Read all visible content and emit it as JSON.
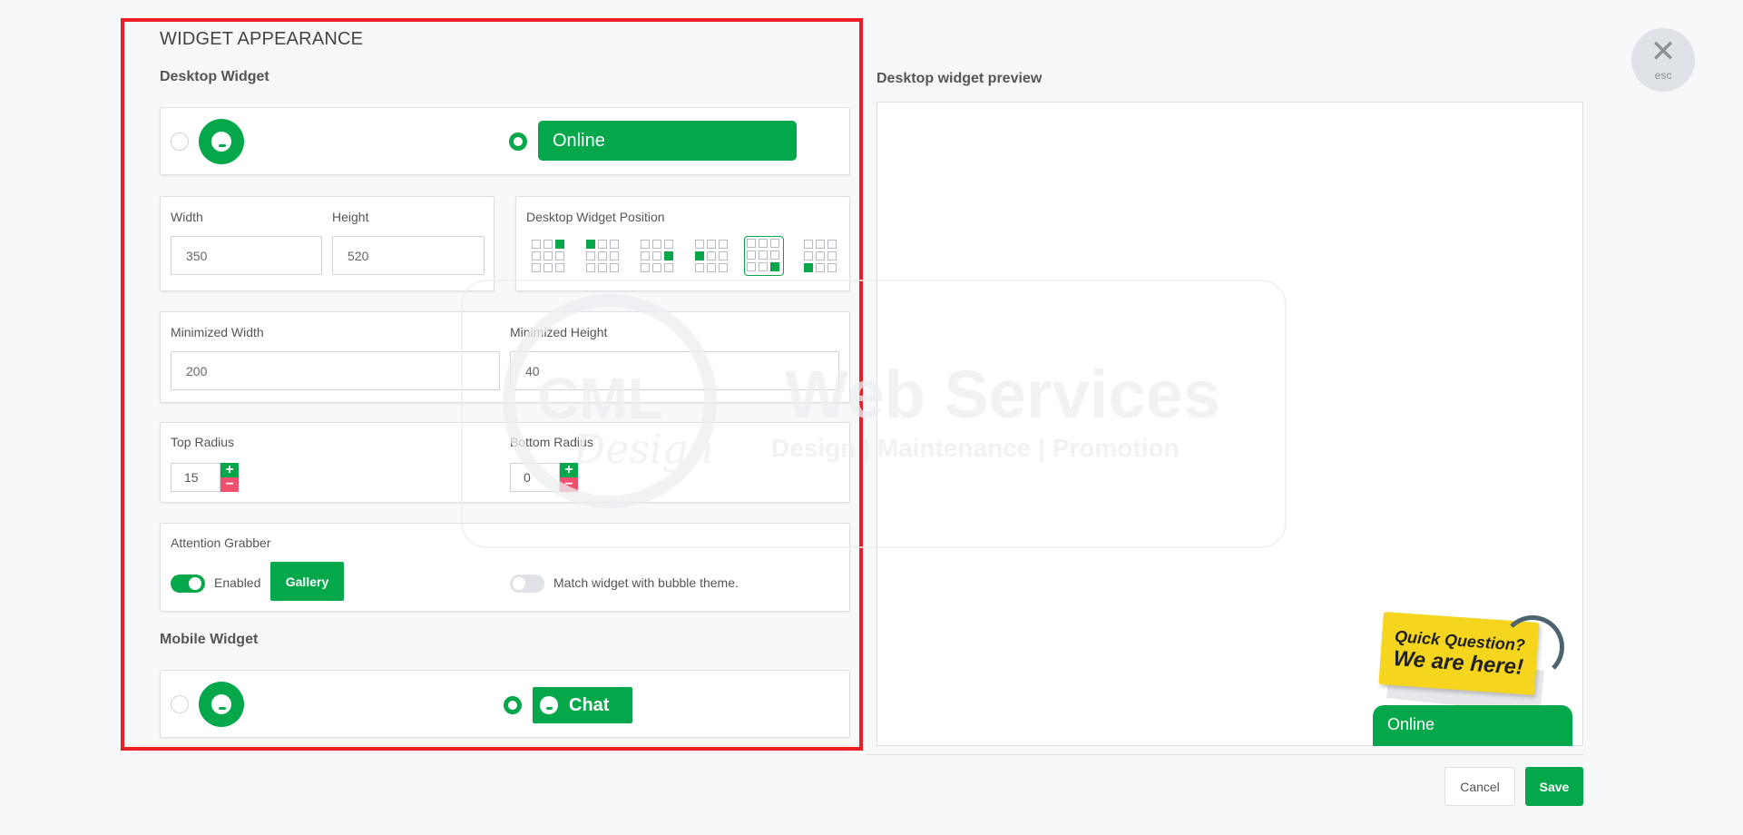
{
  "panel": {
    "title": "WIDGET APPEARANCE",
    "desktop_widget": {
      "heading": "Desktop Widget",
      "style_online_label": "Online",
      "width_label": "Width",
      "width_value": "350",
      "height_label": "Height",
      "height_value": "520",
      "position_label": "Desktop Widget Position",
      "position_options": [
        {
          "name": "top-right",
          "selected": false
        },
        {
          "name": "top-left",
          "selected": false
        },
        {
          "name": "middle-right",
          "selected": false
        },
        {
          "name": "middle-left",
          "selected": false
        },
        {
          "name": "bottom-right",
          "selected": true
        },
        {
          "name": "bottom-left",
          "selected": false
        }
      ],
      "min_width_label": "Minimized Width",
      "min_width_value": "200",
      "min_height_label": "Minimized Height",
      "min_height_value": "40",
      "top_radius_label": "Top Radius",
      "top_radius_value": "15",
      "bottom_radius_label": "Bottom Radius",
      "bottom_radius_value": "0",
      "attention_label": "Attention Grabber",
      "enabled_label": "Enabled",
      "gallery_label": "Gallery",
      "match_label": "Match widget with bubble theme."
    },
    "mobile_widget": {
      "heading": "Mobile Widget",
      "chat_label": "Chat"
    }
  },
  "preview": {
    "title": "Desktop widget preview",
    "sticker_line1": "Quick Question?",
    "sticker_line2": "We are here!",
    "online_label": "Online",
    "watermark_logo": "CML",
    "watermark_script": "Design",
    "watermark_title": "Web Services",
    "watermark_subtitle": "Design | Maintenance | Promotion"
  },
  "actions": {
    "cancel": "Cancel",
    "save": "Save",
    "close_glyph": "✕",
    "close_hint": "esc"
  },
  "colors": {
    "accent": "#04a84b",
    "highlight_border": "#ee1c23",
    "minus": "#f0506e"
  }
}
